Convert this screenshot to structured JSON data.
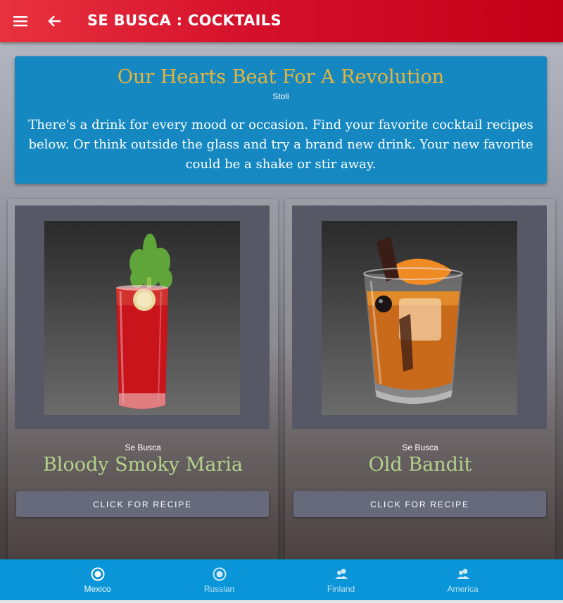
{
  "appbar": {
    "title": "SE BUSCA : COCKTAILS",
    "menu_icon": "menu-icon",
    "back_icon": "arrow-left-icon",
    "color": "#d4102a"
  },
  "banner": {
    "title": "Our Hearts Beat For A Revolution",
    "subtitle": "Stoli",
    "text": "There's a drink for every mood or occasion. Find your favorite cocktail recipes below. Or think outside the glass and try a brand new drink. Your new favorite could be a shake or stir away.",
    "color": "#1588c2",
    "title_color": "#e8b43a"
  },
  "cards": [
    {
      "brand": "Se Busca",
      "name": "Bloody Smoky Maria",
      "button": "CLICK FOR RECIPE",
      "image": "bloody-maria-cocktail-image"
    },
    {
      "brand": "Se Busca",
      "name": "Old Bandit",
      "button": "CLICK FOR RECIPE",
      "image": "old-fashioned-cocktail-image"
    }
  ],
  "bottom_nav": {
    "color": "#0995d8",
    "items": [
      {
        "label": "Mexico",
        "icon": "target-icon",
        "active": true
      },
      {
        "label": "Russian",
        "icon": "target-icon",
        "active": false
      },
      {
        "label": "Finland",
        "icon": "people-icon",
        "active": false
      },
      {
        "label": "America",
        "icon": "people-icon",
        "active": false
      }
    ]
  }
}
